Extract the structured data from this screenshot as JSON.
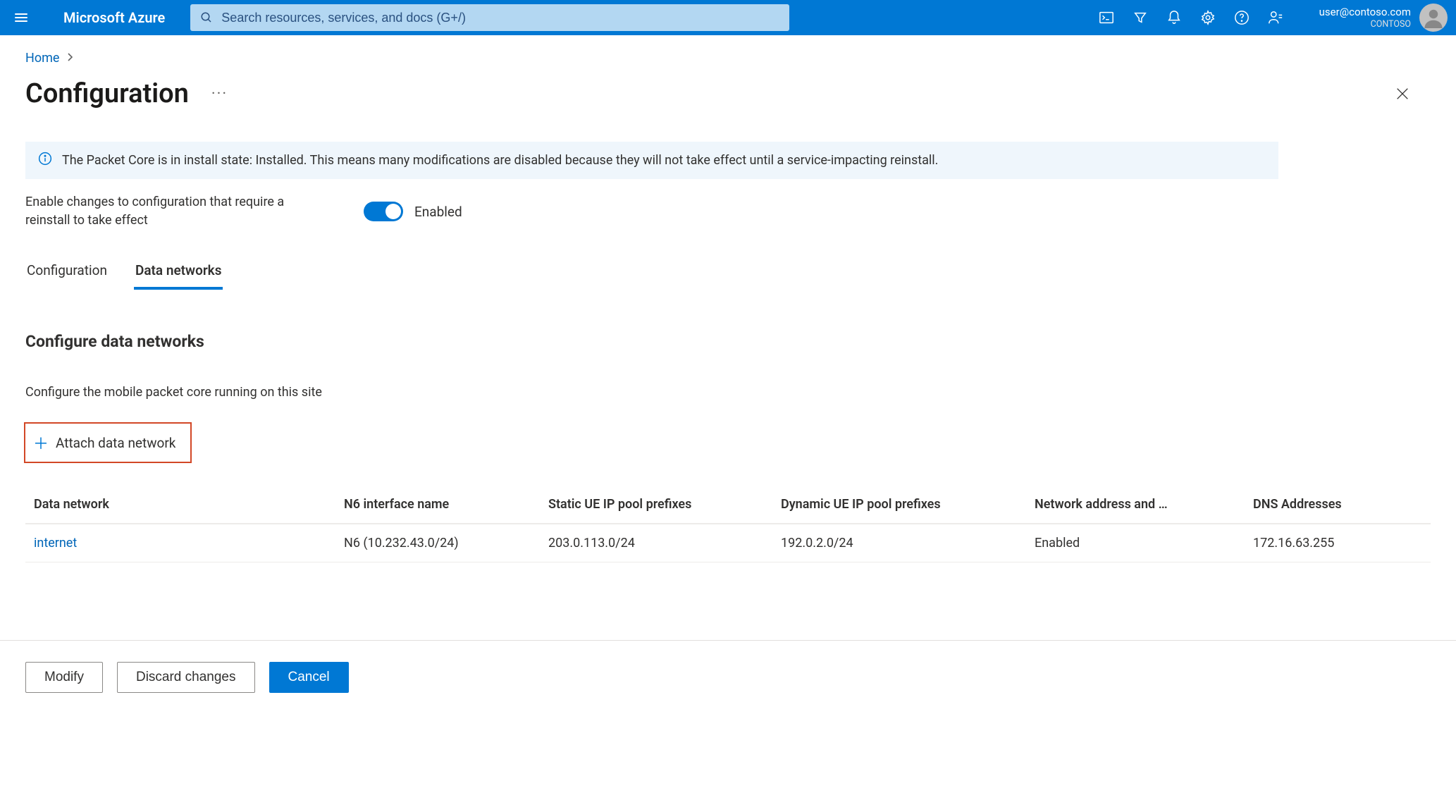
{
  "topbar": {
    "brand": "Microsoft Azure",
    "search_placeholder": "Search resources, services, and docs (G+/)",
    "account": {
      "email": "user@contoso.com",
      "org": "CONTOSO"
    }
  },
  "breadcrumb": {
    "home": "Home"
  },
  "page": {
    "title": "Configuration",
    "info_banner": "The Packet Core is in install state: Installed. This means many modifications are disabled because they will not take effect until a service-impacting reinstall.",
    "toggle_label": "Enable changes to configuration that require a reinstall to take effect",
    "toggle_state": "Enabled",
    "tabs": {
      "configuration": "Configuration",
      "data_networks": "Data networks"
    },
    "section_title": "Configure data networks",
    "section_desc": "Configure the mobile packet core running on this site",
    "attach_label": "Attach data network"
  },
  "table": {
    "headers": {
      "data_network": "Data network",
      "n6": "N6 interface name",
      "static": "Static UE IP pool prefixes",
      "dynamic": "Dynamic UE IP pool prefixes",
      "nap": "Network address and …",
      "dns": "DNS Addresses"
    },
    "rows": [
      {
        "name": "internet",
        "n6": "N6 (10.232.43.0/24)",
        "static": "203.0.113.0/24",
        "dynamic": "192.0.2.0/24",
        "nap": "Enabled",
        "dns": "172.16.63.255"
      }
    ]
  },
  "footer": {
    "modify": "Modify",
    "discard": "Discard changes",
    "cancel": "Cancel"
  }
}
